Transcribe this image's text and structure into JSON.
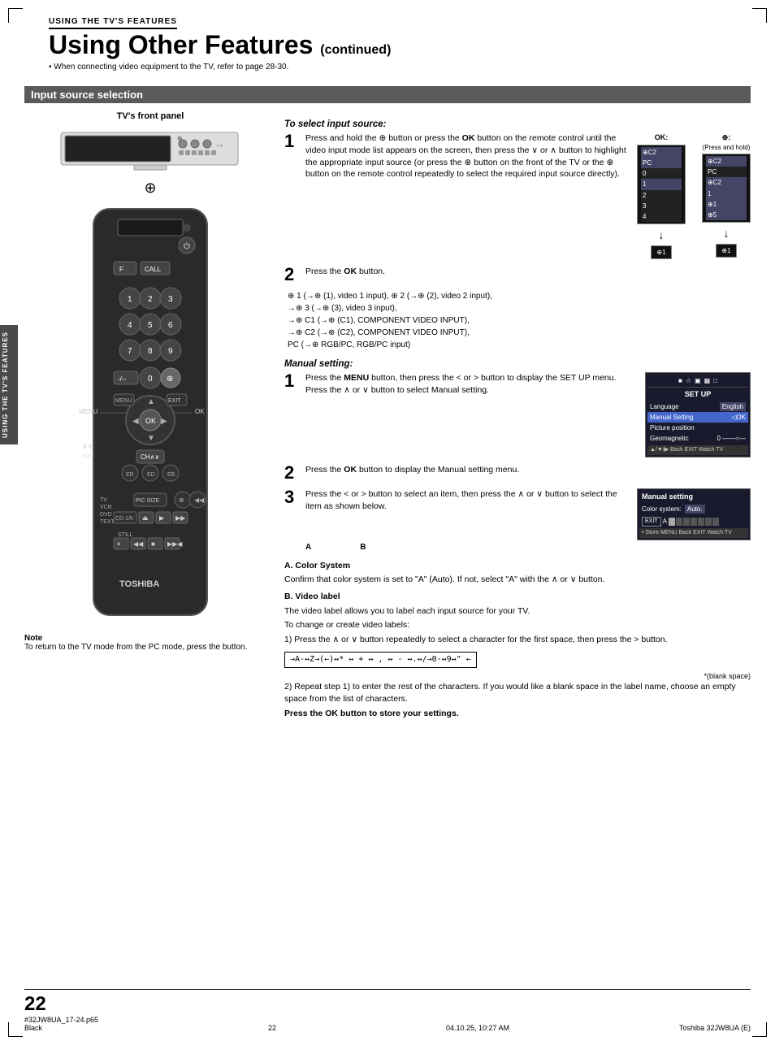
{
  "page": {
    "corner_marks": true,
    "side_tab": "USING THE TV'S FEATURES"
  },
  "header": {
    "subtitle": "USING THE TV'S FEATURES",
    "title": "Using Other Features",
    "continued": "(continued)",
    "note": "• When connecting video equipment to the TV, refer to page 28-30."
  },
  "section": {
    "title": "Input source selection"
  },
  "tv_front_panel": {
    "label": "TV's front panel"
  },
  "select_input": {
    "heading": "To select input source:",
    "step1": {
      "num": "1",
      "text": "Press and hold the  button or press the OK button on the remote control until the video input mode list appears on the screen, then press the ∨ or ∧ button to highlight the appropriate input source (or press the  button on the front of the TV or the  button on the remote control repeatedly to select the required input source directly)."
    },
    "ok_label": "OK:",
    "ant_label": "⊕:",
    "ant_sublabel": "(Press and hold)",
    "step2": {
      "num": "2",
      "text": "Press the OK button."
    },
    "step2_detail": "⊕ 1 (→⊕ (1), video 1 input),  ⊕ 2 (→⊕ (2), video 2 input),",
    "step2_detail2": "→⊕ 3 (→⊕ (3), video 3 input),",
    "step2_detail3": "→⊕ C1 (→⊕ (C1), COMPONENT VIDEO INPUT),",
    "step2_detail4": "→⊕ C2 (→⊕ (C2), COMPONENT VIDEO INPUT),",
    "step2_detail5": "PC (→⊕ RGB/PC, RGB/PC input)"
  },
  "manual_setting": {
    "heading": "Manual setting:",
    "step1": {
      "num": "1",
      "text": "Press the MENU button, then press the < or > button to display the SET UP menu. Press the ∧ or ∨ button to select Manual setting."
    },
    "step2": {
      "num": "2",
      "text": "Press the OK button to display the Manual setting menu."
    },
    "step3": {
      "num": "3",
      "text": "Press the < or > button to select an item, then press the ∧ or ∨ button to select the item as shown below."
    },
    "setup_menu": {
      "title": "SET UP",
      "rows": [
        {
          "label": "Language",
          "value": "English",
          "highlight": false
        },
        {
          "label": "Manual Setting",
          "value": "◁OK",
          "highlight": true
        },
        {
          "label": "Picture position",
          "value": "",
          "highlight": false
        },
        {
          "label": "Geomagnetic",
          "value": "0  ——○—",
          "highlight": false
        }
      ],
      "footer": "▲/▼/▶ Back  EXIT Watch TV"
    },
    "manual_menu": {
      "title": "Manual setting",
      "color_row": "Color system: Auto.",
      "footer": "• Store MENU Back  EXIT Watch TV",
      "ab_labels": [
        "A",
        "B"
      ]
    }
  },
  "color_system": {
    "label_a": "A. Color System",
    "text_a": "Confirm that color system is set to \"A\" (Auto). If not, select \"A\" with the ∧ or ∨ button."
  },
  "video_label": {
    "label_b": "B. Video label",
    "text_b": "The video label allows you to label each input source for your TV.",
    "change_label": "To change or create video labels:",
    "step1_text": "1)  Press the ∧ or ∨ button repeatedly to select a character for the first space, then press the > button.",
    "char_sequence": "→A-↔Z→(←)↔* ↔ + ↔ , ↔ - ↔.↔/→0-↔9↔\" ←",
    "blank_note": "*(blank space)",
    "step2_text": "2)  Repeat step 1) to enter the rest of the characters. If you would like a blank space in the label name, choose an empty space from the list of characters.",
    "ok_store": "Press the OK button to store your settings."
  },
  "note": {
    "title": "Note",
    "text": "To return to the TV mode from the PC mode, press the  button."
  },
  "footer": {
    "left": "#32JW8UA_17-24.p65",
    "center": "22",
    "date": "04.10.25, 10:27 AM",
    "color": "Black",
    "page_num": "22",
    "right": "Toshiba 32JW8UA (E)"
  },
  "labels": {
    "menu_label": "MENU",
    "ok_label": "OK",
    "exit_label": "EXIT"
  }
}
